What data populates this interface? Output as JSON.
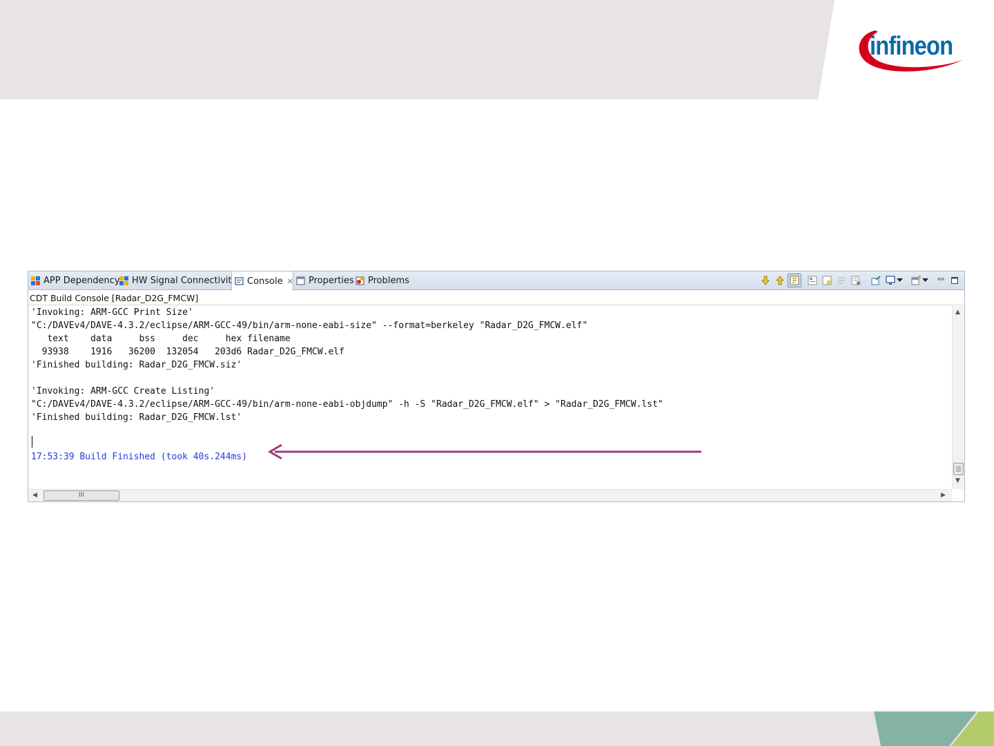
{
  "brand": {
    "logo_text": "infineon",
    "colors": {
      "band": "#e8e4e4",
      "logo_blue": "#0a69a8",
      "logo_red": "#d5001c",
      "accent_teal": "#84b3a3",
      "accent_green": "#b3cc6a",
      "arrow": "#9e3a7c"
    }
  },
  "tabs": [
    {
      "label": "APP Dependency",
      "icon": "app-dependency-icon"
    },
    {
      "label": "HW Signal Connectivity",
      "icon": "hw-signal-icon"
    },
    {
      "label": "Console",
      "icon": "console-icon",
      "active": true,
      "closable": true
    },
    {
      "label": "Properties",
      "icon": "properties-icon"
    },
    {
      "label": "Problems",
      "icon": "problems-icon"
    }
  ],
  "toolbar": [
    "scroll-down-icon",
    "scroll-up-icon",
    "scroll-lock-icon",
    "word-wrap-icon",
    "show-on-output-icon",
    "clear-console-icon",
    "remove-console-icon",
    "pin-console-icon",
    "display-console-icon",
    "display-console-dropdown-icon",
    "open-console-icon",
    "open-console-dropdown-icon",
    "minimize-icon",
    "maximize-icon"
  ],
  "console": {
    "title": "CDT Build Console [Radar_D2G_FMCW]",
    "lines": [
      "'Invoking: ARM-GCC Print Size'",
      "\"C:/DAVEv4/DAVE-4.3.2/eclipse/ARM-GCC-49/bin/arm-none-eabi-size\" --format=berkeley \"Radar_D2G_FMCW.elf\"",
      "   text    data     bss     dec     hex filename",
      "  93938    1916   36200  132054   203d6 Radar_D2G_FMCW.elf",
      "'Finished building: Radar_D2G_FMCW.siz'",
      "",
      "'Invoking: ARM-GCC Create Listing'",
      "\"C:/DAVEv4/DAVE-4.3.2/eclipse/ARM-GCC-49/bin/arm-none-eabi-objdump\" -h -S \"Radar_D2G_FMCW.elf\" > \"Radar_D2G_FMCW.lst\"",
      "'Finished building: Radar_D2G_FMCW.lst'",
      "",
      "",
      "17:53:39 Build Finished (took 40s.244ms)"
    ]
  },
  "scrollbar": {
    "h_thumb_grip": "III"
  }
}
